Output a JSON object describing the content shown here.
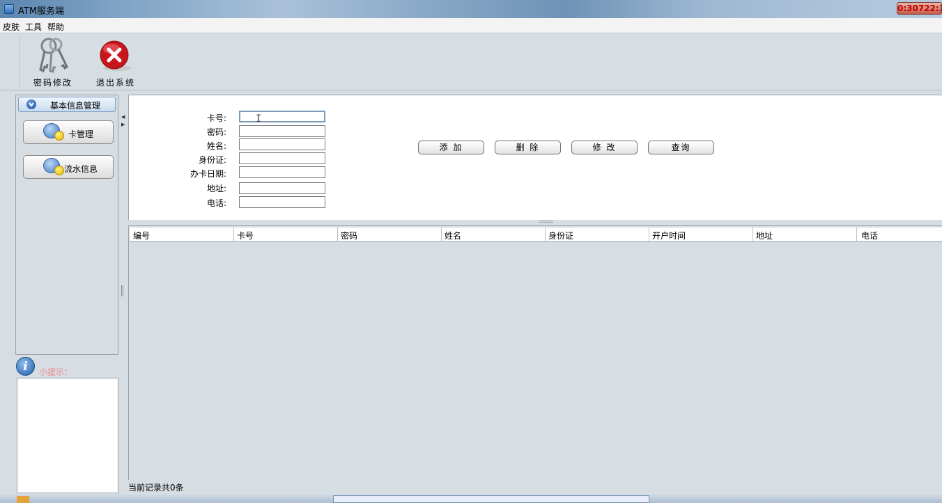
{
  "window": {
    "title": "ATM服务端",
    "controls_text": "0:30722:3"
  },
  "menu": [
    "皮肤",
    "工具",
    "帮助"
  ],
  "toolbar": {
    "change_password": "密码修改",
    "exit_system": "退出系统"
  },
  "sidebar": {
    "section_title": "基本信息管理",
    "items": [
      {
        "label": "卡管理"
      },
      {
        "label": "流水信息"
      }
    ],
    "tip_title": "小提示："
  },
  "form": {
    "fields": [
      {
        "label": "卡号:",
        "value": ""
      },
      {
        "label": "密码:",
        "value": ""
      },
      {
        "label": "姓名:",
        "value": ""
      },
      {
        "label": "身份证:",
        "value": ""
      },
      {
        "label": "办卡日期:",
        "value": ""
      },
      {
        "label": "地址:",
        "value": ""
      },
      {
        "label": "电话:",
        "value": ""
      }
    ],
    "buttons": {
      "add": "添 加",
      "delete": "删 除",
      "modify": "修 改",
      "query": "查询"
    }
  },
  "table": {
    "columns": [
      "编号",
      "卡号",
      "密码",
      "姓名",
      "身份证",
      "开户时间",
      "地址",
      "电话"
    ],
    "rows": []
  },
  "status": "当前记录共0条"
}
